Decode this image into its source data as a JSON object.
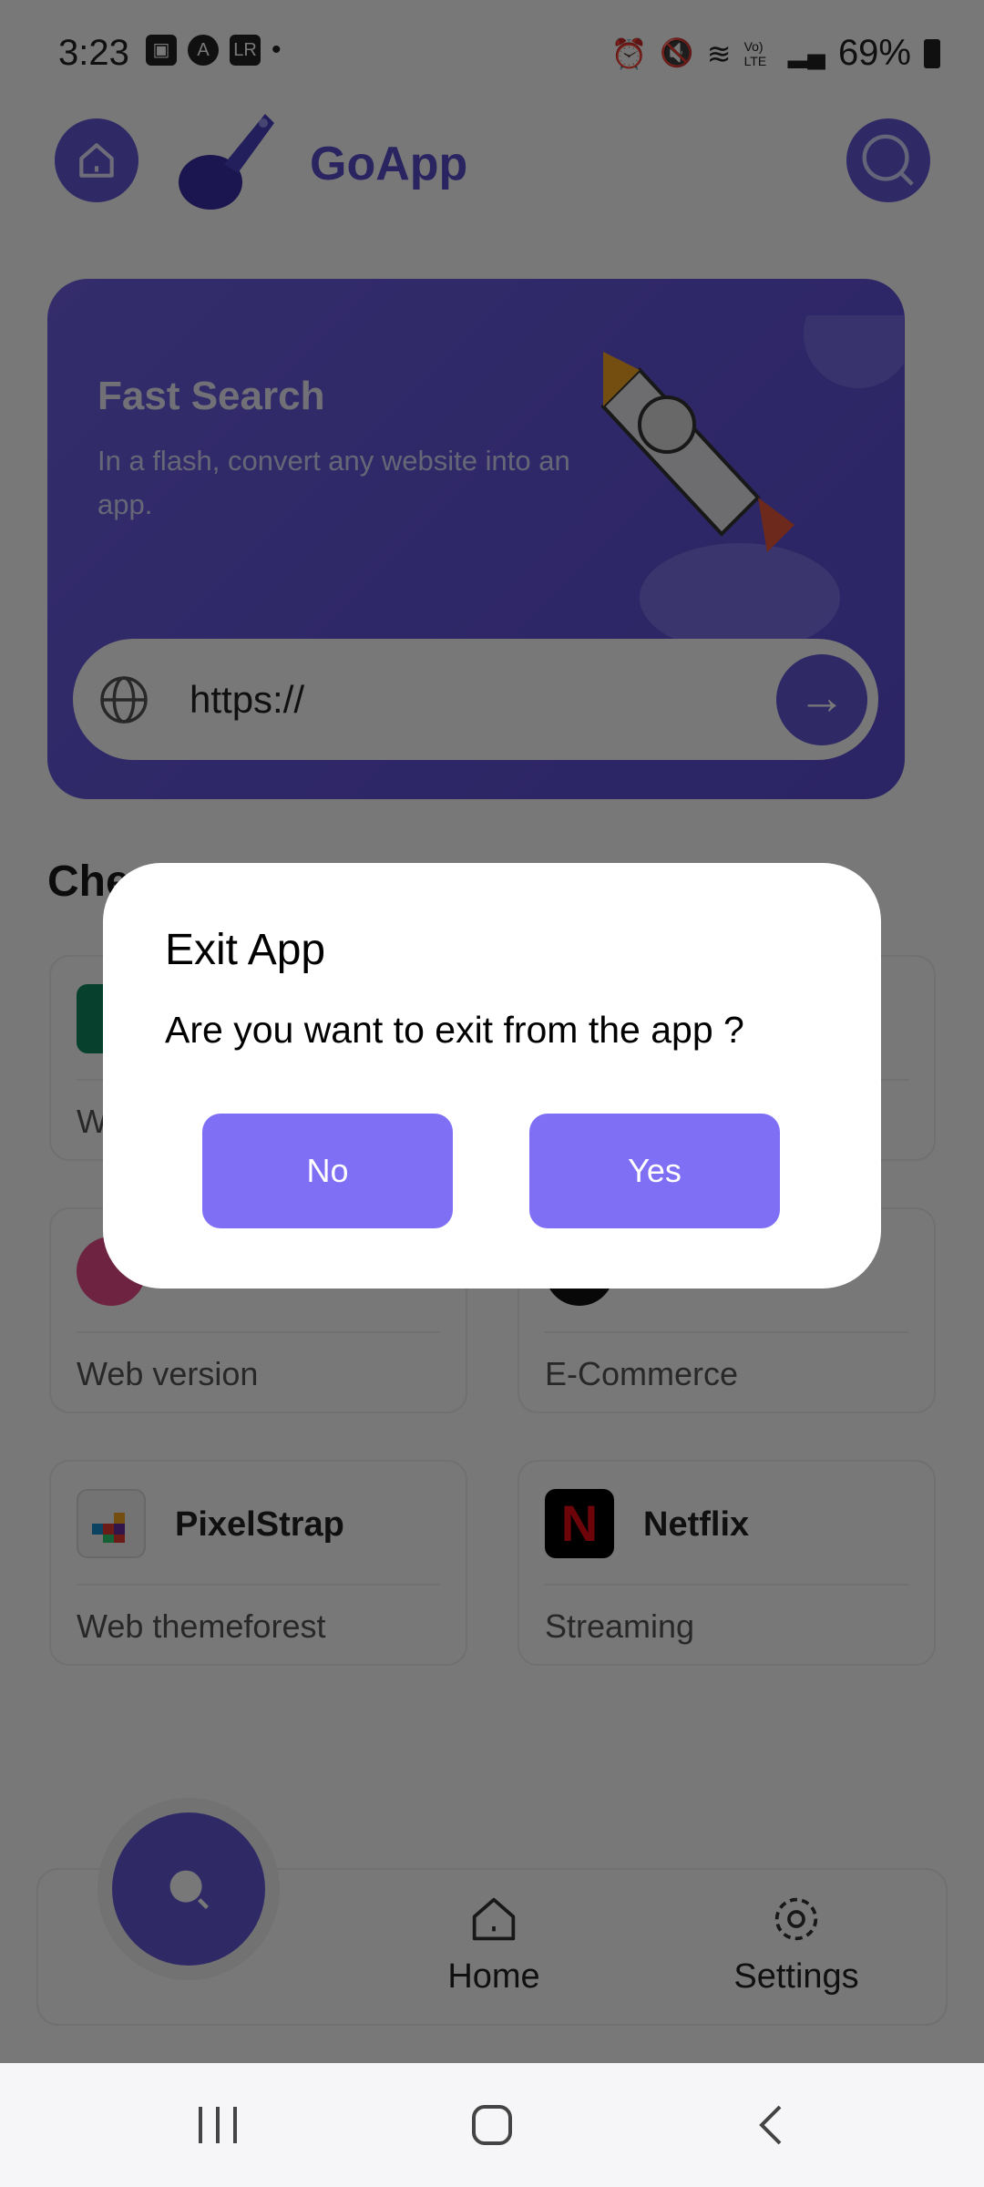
{
  "status_bar": {
    "time": "3:23",
    "battery": "69%",
    "icons": [
      "gallery-icon",
      "a-icon",
      "lr-icon",
      "dot-icon",
      "alarm-icon",
      "mute-icon",
      "wifi-icon",
      "volte-icon",
      "signal-icon",
      "battery-charging-icon"
    ],
    "volte": "Vo) LTE",
    "lr": "LR",
    "a": "A"
  },
  "header": {
    "app_name": "GoApp"
  },
  "banner": {
    "title": "Fast Search",
    "subtitle": "In a flash, convert any website into an app.",
    "url_value": "https://",
    "url_placeholder": "https://"
  },
  "section": {
    "heading": "Che"
  },
  "cards": [
    {
      "name": "",
      "subtitle": "W",
      "icon_color": "#0f8a5f"
    },
    {
      "name": "",
      "subtitle": "",
      "icon_color": "#ffffff"
    },
    {
      "name": "",
      "subtitle": "Web version",
      "icon_color": "#ea4c89"
    },
    {
      "name": "",
      "subtitle": "E-Commerce",
      "icon_color": "#111111"
    },
    {
      "name": "PixelStrap",
      "subtitle": "Web themeforest",
      "icon_color": "#f4f4f4"
    },
    {
      "name": "Netflix",
      "subtitle": "Streaming",
      "icon_color": "#000000",
      "letter": "N"
    }
  ],
  "bottom_nav": {
    "home": "Home",
    "settings": "Settings"
  },
  "dialog": {
    "title": "Exit App",
    "message": "Are you want to exit from the app ?",
    "no": "No",
    "yes": "Yes"
  },
  "colors": {
    "accent": "#6558d8",
    "dialog_button": "#7f6ff5"
  }
}
